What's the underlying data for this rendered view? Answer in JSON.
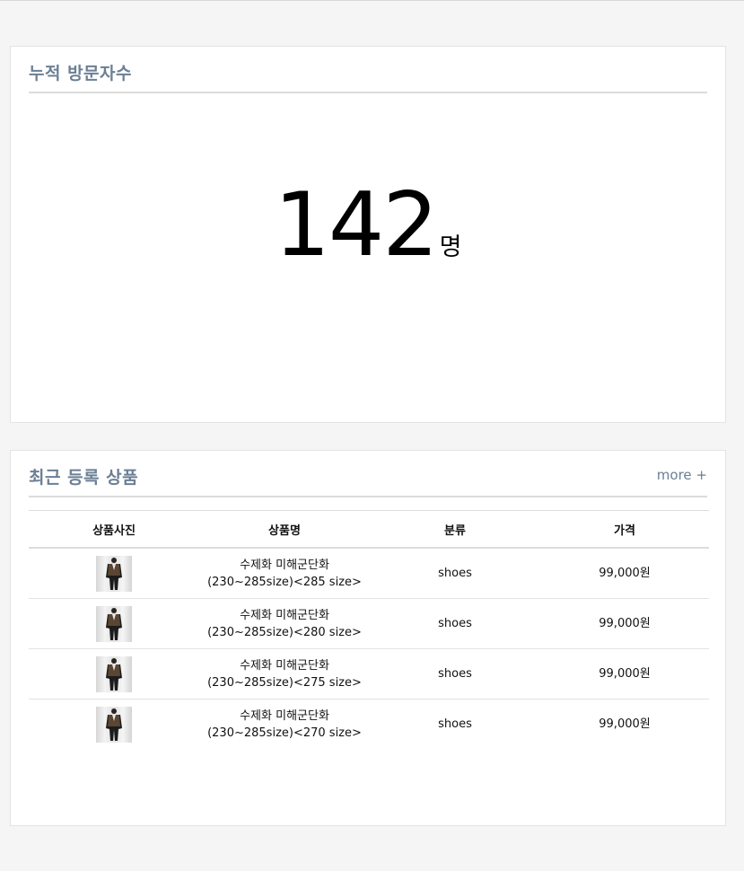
{
  "visitors": {
    "title": "누적 방문자수",
    "count": "142",
    "unit": "명"
  },
  "products": {
    "title": "최근 등록 상품",
    "more_label": "more +",
    "columns": [
      "상품사진",
      "상품명",
      "분류",
      "가격"
    ],
    "rows": [
      {
        "name_line1": "수제화 미해군단화",
        "name_line2": "(230~285size)<285 size>",
        "category": "shoes",
        "price": "99,000원",
        "thumb_icon": "suit-photo"
      },
      {
        "name_line1": "수제화 미해군단화",
        "name_line2": "(230~285size)<280 size>",
        "category": "shoes",
        "price": "99,000원",
        "thumb_icon": "suit-photo"
      },
      {
        "name_line1": "수제화 미해군단화",
        "name_line2": "(230~285size)<275 size>",
        "category": "shoes",
        "price": "99,000원",
        "thumb_icon": "suit-photo"
      },
      {
        "name_line1": "수제화 미해군단화",
        "name_line2": "(230~285size)<270 size>",
        "category": "shoes",
        "price": "99,000원",
        "thumb_icon": "suit-photo"
      }
    ]
  },
  "colors": {
    "title_text": "#6b7f95",
    "background": "#f5f5f5",
    "panel": "#ffffff"
  }
}
